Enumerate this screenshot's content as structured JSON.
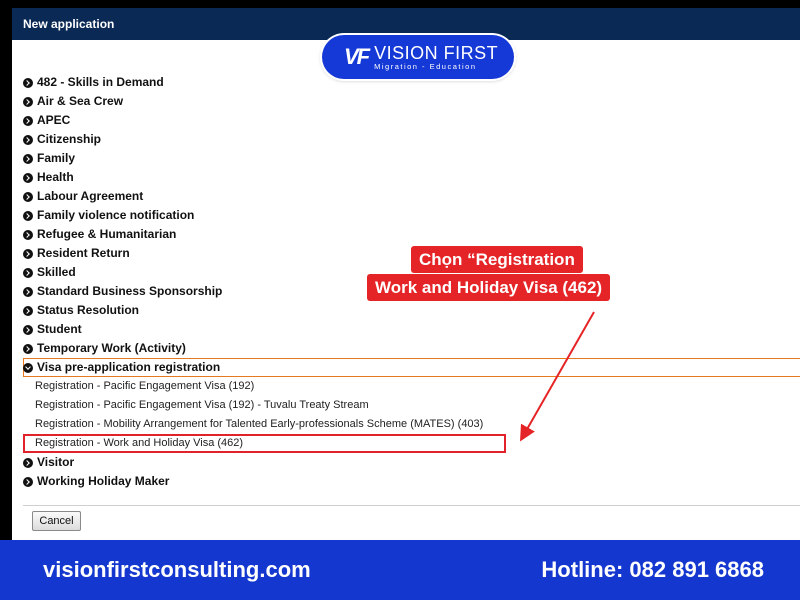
{
  "window": {
    "title": "New application"
  },
  "logo": {
    "mark": "VF",
    "title": "VISION FIRST",
    "subtitle": "Migration - Education"
  },
  "categories_before": [
    "482 - Skills in Demand",
    "Air & Sea Crew",
    "APEC",
    "Citizenship",
    "Family",
    "Health",
    "Labour Agreement",
    "Family violence notification",
    "Refugee & Humanitarian",
    "Resident Return",
    "Skilled",
    "Standard Business Sponsorship",
    "Status Resolution",
    "Student",
    "Temporary Work (Activity)"
  ],
  "expanded_category": "Visa pre-application registration",
  "sub_items": [
    "Registration - Pacific Engagement Visa (192)",
    "Registration - Pacific Engagement Visa (192) - Tuvalu Treaty Stream",
    "Registration - Mobility Arrangement for Talented Early-professionals Scheme (MATES) (403)",
    "Registration - Work and Holiday Visa (462)"
  ],
  "categories_after": [
    "Visitor",
    "Working Holiday Maker"
  ],
  "buttons": {
    "cancel": "Cancel"
  },
  "callout": {
    "line1": "Chọn “Registration",
    "line2": "Work and Holiday Visa (462)"
  },
  "footer": {
    "website": "visionfirstconsulting.com",
    "hotline": "Hotline: 082 891 6868"
  },
  "colors": {
    "titlebar": "#0a2a55",
    "brand_blue": "#1437cf",
    "highlight_red": "#e2222a",
    "expanded_border": "#e8781e"
  },
  "icons": {
    "category": "circle-chevron-right-icon",
    "expanded": "circle-chevron-down-icon"
  }
}
